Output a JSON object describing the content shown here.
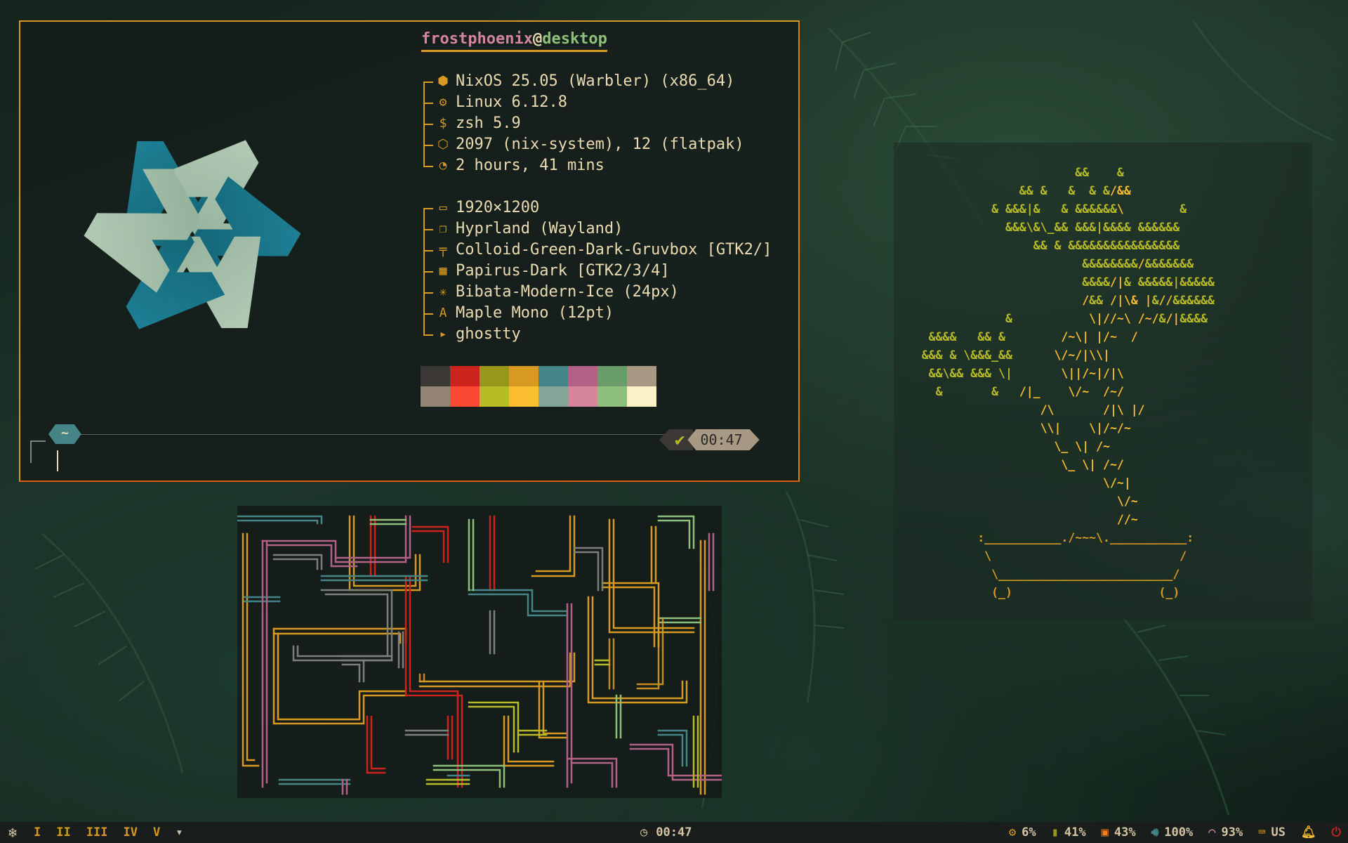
{
  "fastfetch": {
    "user": "frostphoenix",
    "at": "@",
    "host": "desktop",
    "group1": [
      {
        "icon": "nixos-icon",
        "value": "NixOS 25.05 (Warbler) (x86_64)"
      },
      {
        "icon": "kernel-icon",
        "value": "Linux 6.12.8"
      },
      {
        "icon": "shell-icon",
        "value": "zsh 5.9"
      },
      {
        "icon": "package-icon",
        "value": "2097 (nix-system), 12 (flatpak)"
      },
      {
        "icon": "uptime-icon",
        "value": "2 hours, 41 mins"
      }
    ],
    "group2": [
      {
        "icon": "display-icon",
        "value": "1920×1200"
      },
      {
        "icon": "window-manager-icon",
        "value": "Hyprland (Wayland)"
      },
      {
        "icon": "theme-icon",
        "value": "Colloid-Green-Dark-Gruvbox [GTK2/]"
      },
      {
        "icon": "icons-icon",
        "value": "Papirus-Dark [GTK2/3/4]"
      },
      {
        "icon": "cursor-icon",
        "value": "Bibata-Modern-Ice (24px)"
      },
      {
        "icon": "font-icon",
        "value": "Maple Mono (12pt)"
      },
      {
        "icon": "terminal-icon",
        "value": "ghostty"
      }
    ],
    "palette": [
      "#3c3836",
      "#cc241d",
      "#98971a",
      "#d79921",
      "#458588",
      "#b16286",
      "#689d6a",
      "#a89984",
      "#928374",
      "#fb4934",
      "#b8bb26",
      "#fabd2f",
      "#83a598",
      "#d3869b",
      "#8ec07c",
      "#fbf1c7"
    ]
  },
  "prompt": {
    "cwd": "~",
    "status": "✔",
    "time": "00:47"
  },
  "bar": {
    "workspaces": [
      "I",
      "II",
      "III",
      "IV",
      "V"
    ],
    "clock": "00:47",
    "cpu": "6%",
    "memory": "41%",
    "disk": "43%",
    "volume": "100%",
    "wifi": "93%",
    "keyboard": "US",
    "colors": {
      "accent": "#d79921",
      "alert": "#cc241d"
    }
  }
}
